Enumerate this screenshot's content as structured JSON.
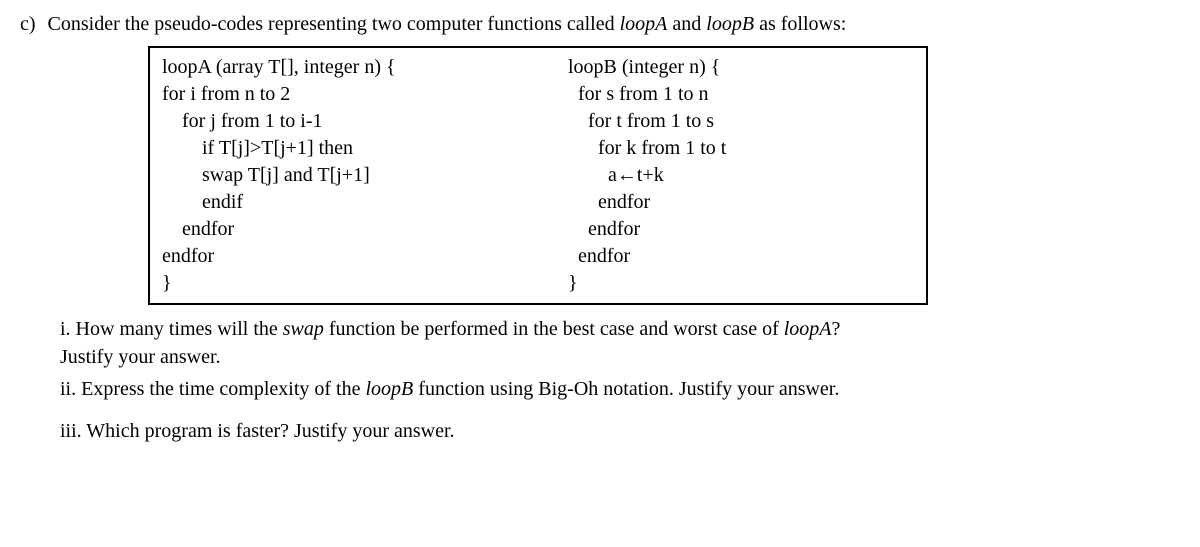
{
  "question": {
    "label": "c)",
    "intro_1": "Consider the pseudo-codes representing two computer functions called ",
    "fn_a": "loopA",
    "intro_2": " and ",
    "fn_b": "loopB",
    "intro_3": " as follows:"
  },
  "code": {
    "loopA": {
      "l1": "loopA (array T[], integer n) {",
      "l2": "for i from n to 2",
      "l3": "    for j from 1 to i-1",
      "l4": "        if T[j]>T[j+1] then",
      "l5": "        swap T[j] and T[j+1]",
      "l6": "        endif",
      "l7": "    endfor",
      "l8": "endfor",
      "l9": "}"
    },
    "loopB": {
      "l1": "loopB (integer n) {",
      "l2": "  for s from 1 to n",
      "l3": "    for t from 1 to s",
      "l4": "      for k from 1 to t",
      "l5": "        a←t+k",
      "l6": "      endfor",
      "l7": "    endfor",
      "l8": "  endfor",
      "l9": "}"
    }
  },
  "subquestions": {
    "i_p1": "i. How many times will the ",
    "i_swap": "swap",
    "i_p2": " function be performed in the best case and worst case of ",
    "i_fn": "loopA",
    "i_p3": "?",
    "i_justify": "Justify your answer.",
    "ii_p1": "ii. Express the time complexity of the ",
    "ii_fn": "loopB",
    "ii_p2": " function using Big-Oh notation. Justify your answer.",
    "iii": "iii. Which program is faster? Justify your answer."
  }
}
